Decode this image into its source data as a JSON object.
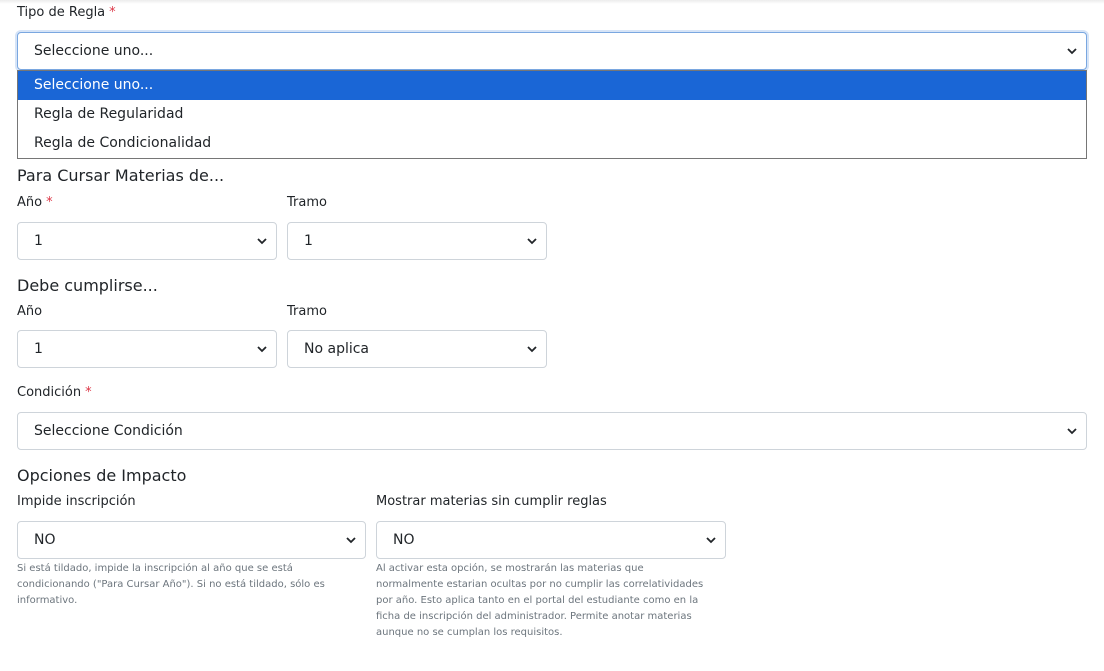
{
  "tipo_regla": {
    "label": "Tipo de Regla",
    "required_mark": "*",
    "selected": "Seleccione uno...",
    "options": [
      "Seleccione uno...",
      "Regla de Regularidad",
      "Regla de Condicionalidad"
    ]
  },
  "para_cursar": {
    "heading": "Para Cursar Materias de...",
    "anio_label": "Año",
    "anio_required_mark": "*",
    "anio_value": "1",
    "tramo_label": "Tramo",
    "tramo_value": "1"
  },
  "debe_cumplirse": {
    "heading": "Debe cumplirse...",
    "anio_label": "Año",
    "anio_value": "1",
    "tramo_label": "Tramo",
    "tramo_value": "No aplica"
  },
  "condicion": {
    "label": "Condición",
    "required_mark": "*",
    "selected": "Seleccione Condición"
  },
  "opciones_impacto": {
    "heading": "Opciones de Impacto",
    "impide": {
      "label": "Impide inscripción",
      "value": "NO",
      "help_lines": [
        "Si está tildado, impide la inscripción al año que se está",
        "condicionando (\"Para Cursar Año\"). Si no está tildado, sólo es",
        "informativo."
      ]
    },
    "mostrar": {
      "label": "Mostrar materias sin cumplir reglas",
      "value": "NO",
      "help_lines": [
        "Al activar esta opción, se mostrarán las materias que",
        "normalmente estarian ocultas por no cumplir las correlatividades",
        "por año. Esto aplica tanto en el portal del estudiante como en la",
        "ficha de inscripción del administrador. Permite anotar materias",
        "aunque no se cumplan los requisitos."
      ]
    }
  },
  "icons": {
    "select_arrow": "chevron-down-icon"
  },
  "colors": {
    "required": "#dc3545",
    "highlight": "#1a66d6",
    "focus_border": "#7aa7e0"
  }
}
